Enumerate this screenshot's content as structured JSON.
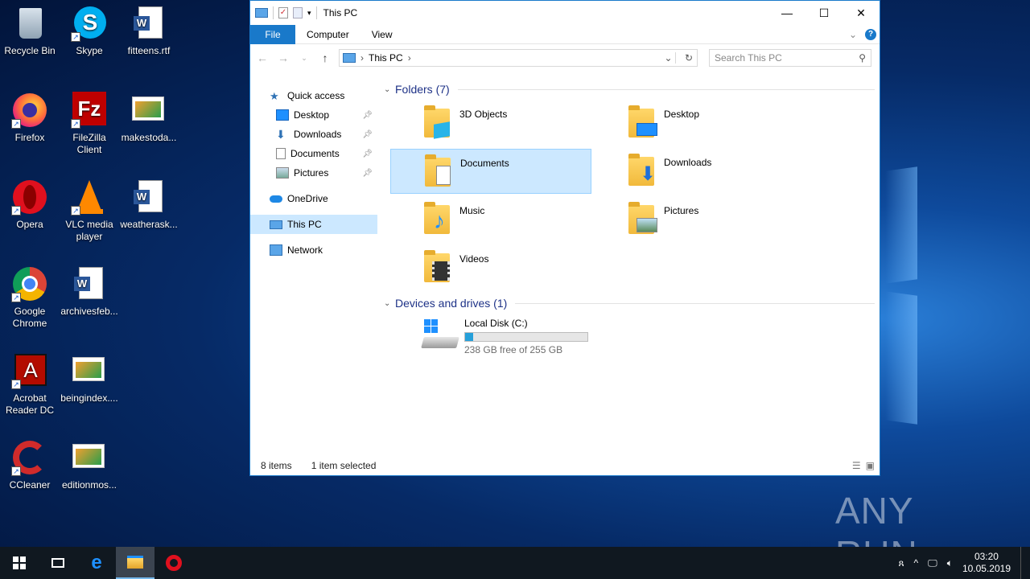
{
  "desktop": {
    "icons": [
      {
        "label": "Recycle Bin",
        "icon": "recycle-bin-icon"
      },
      {
        "label": "Skype",
        "icon": "skype-icon"
      },
      {
        "label": "fitteens.rtf",
        "icon": "word-doc-icon"
      },
      {
        "label": "Firefox",
        "icon": "firefox-icon"
      },
      {
        "label": "FileZilla Client",
        "icon": "filezilla-icon"
      },
      {
        "label": "makestoda...",
        "icon": "image-file-icon"
      },
      {
        "label": "Opera",
        "icon": "opera-icon"
      },
      {
        "label": "VLC media player",
        "icon": "vlc-icon"
      },
      {
        "label": "weatherask...",
        "icon": "word-doc-icon"
      },
      {
        "label": "Google Chrome",
        "icon": "chrome-icon"
      },
      {
        "label": "archivesfeb...",
        "icon": "word-doc-icon"
      },
      {
        "label": "Acrobat Reader DC",
        "icon": "acrobat-icon"
      },
      {
        "label": "beingindex....",
        "icon": "image-file-icon"
      },
      {
        "label": "CCleaner",
        "icon": "ccleaner-icon"
      },
      {
        "label": "editionmos...",
        "icon": "image-file-icon"
      }
    ],
    "watermark": "ANY RUN"
  },
  "window": {
    "title": "This PC",
    "ribbon_tabs": {
      "file": "File",
      "computer": "Computer",
      "view": "View"
    },
    "address": {
      "location": "This PC"
    },
    "search": {
      "placeholder": "Search This PC"
    },
    "nav": {
      "quick_access": "Quick access",
      "desktop": "Desktop",
      "downloads": "Downloads",
      "documents": "Documents",
      "pictures": "Pictures",
      "onedrive": "OneDrive",
      "this_pc": "This PC",
      "network": "Network"
    },
    "folders_header": "Folders (7)",
    "folders": {
      "objects3d": "3D Objects",
      "desktop": "Desktop",
      "documents": "Documents",
      "downloads": "Downloads",
      "music": "Music",
      "pictures": "Pictures",
      "videos": "Videos"
    },
    "devices_header": "Devices and drives (1)",
    "drive": {
      "name": "Local Disk (C:)",
      "free": "238 GB free of 255 GB",
      "used_fraction": 0.067
    },
    "status": {
      "items": "8 items",
      "selected": "1 item selected"
    }
  },
  "taskbar": {
    "time": "03:20",
    "date": "10.05.2019"
  },
  "colors": {
    "accent": "#1979ca",
    "selection": "#cce8ff",
    "folder_header": "#1e3287"
  }
}
